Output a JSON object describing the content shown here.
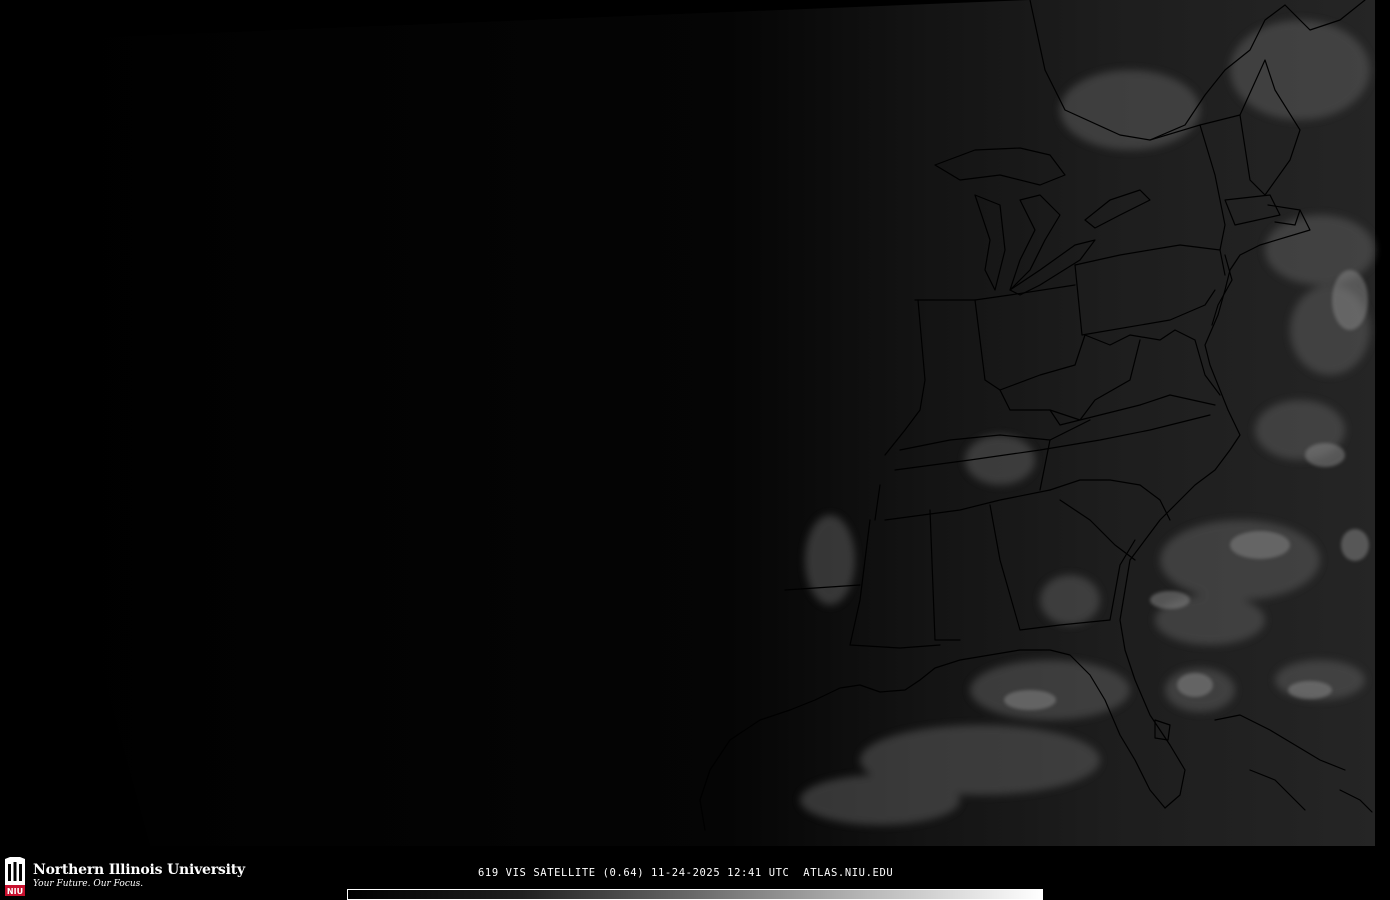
{
  "product": {
    "caption": "619 VIS SATELLITE (0.64) 11-24-2025 12:41 UTC  ATLAS.NIU.EDU"
  },
  "branding": {
    "university": "Northern Illinois University",
    "tagline": "Your Future. Our Focus.",
    "logo_text": "NIU",
    "logo_color": "#c8102e"
  },
  "colorbar": {
    "low_color": "#000000",
    "high_color": "#ffffff"
  },
  "colors": {
    "background": "#000000",
    "border_lines": "#000000",
    "text": "#ffffff"
  }
}
